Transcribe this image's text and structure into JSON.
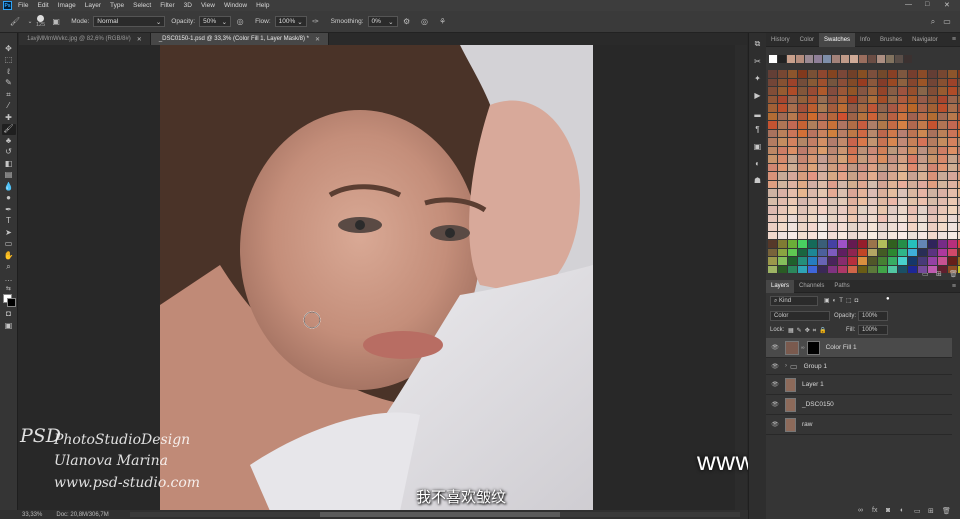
{
  "menubar": {
    "logo": "Ps",
    "items": [
      "File",
      "Edit",
      "Image",
      "Layer",
      "Type",
      "Select",
      "Filter",
      "3D",
      "View",
      "Window",
      "Help"
    ],
    "min": "—",
    "max": "□",
    "close": "✕"
  },
  "options": {
    "brush_size": "125",
    "mode_label": "Mode:",
    "mode_value": "Normal",
    "opacity_label": "Opacity:",
    "opacity_value": "50%",
    "flow_label": "Flow:",
    "flow_value": "100%",
    "smoothing_label": "Smoothing:",
    "smoothing_value": "0%"
  },
  "tabs": [
    {
      "label": "1avjMMmWvkc.jpg @ 82,6% (RGB/8#)",
      "close": "✕"
    },
    {
      "label": "_DSC0150-1.psd @ 33,3% (Color Fill 1, Layer Mask/8) *",
      "close": "✕"
    }
  ],
  "status": {
    "zoom": "33,33%",
    "doc": "Doc: 20,8M/306,7M"
  },
  "panel_tabs_top": [
    "History",
    "Color",
    "Swatches",
    "Info",
    "Brushes",
    "Navigator"
  ],
  "panel_tabs_layers": [
    "Layers",
    "Channels",
    "Paths"
  ],
  "layers_panel": {
    "kind": "Kind",
    "blend": "Color",
    "opacity_label": "Opacity:",
    "opacity_value": "100%",
    "lock_label": "Lock:",
    "fill_label": "Fill:",
    "fill_value": "100%"
  },
  "layers": [
    {
      "name": "Color Fill 1",
      "selected": true,
      "thumb": "#7a5a4e"
    },
    {
      "name": "Group 1",
      "selected": false,
      "thumb": ""
    },
    {
      "name": "Layer 1",
      "selected": false,
      "thumb": "#8d6a5a"
    },
    {
      "name": "_DSC0150",
      "selected": false,
      "thumb": "#8d6a5a"
    },
    {
      "name": "raw",
      "selected": false,
      "thumb": "#8d6a5a"
    }
  ],
  "watermark": {
    "line1": "PhotoStudioDesign",
    "line2": "Ulanova Marina",
    "line3": "www.psd-studio.com",
    "logo": "PSD"
  },
  "subtitle": "我不喜欢皱纹",
  "site": "www.hunls.com"
}
